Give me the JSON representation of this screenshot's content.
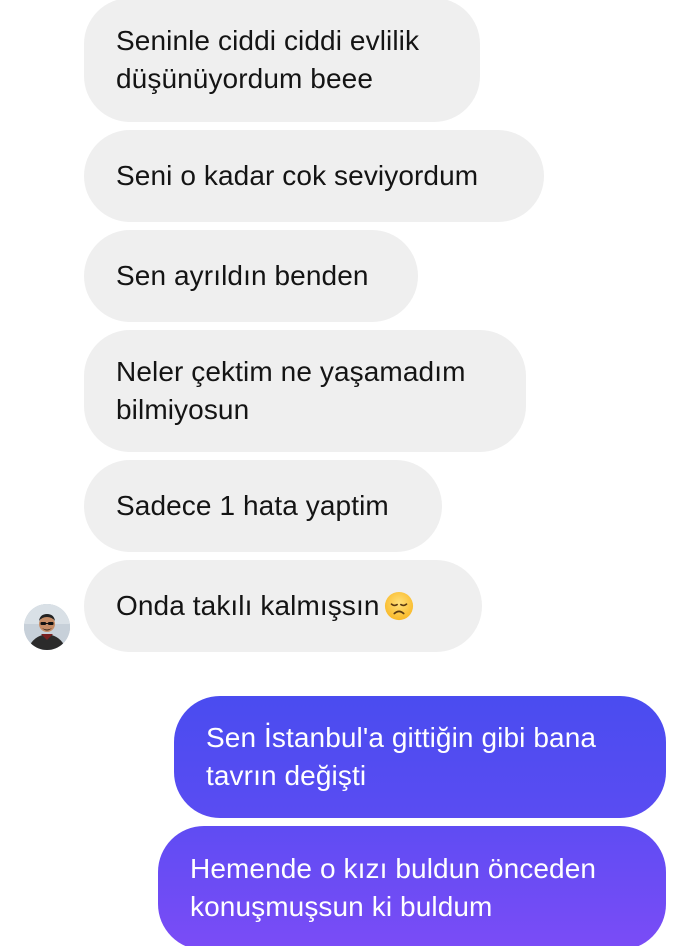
{
  "conversation": {
    "received": [
      {
        "text": "Seninle ciddi ciddi evlilik\ndüşünüyordum beee"
      },
      {
        "text": "Seni o kadar cok seviyordum"
      },
      {
        "text": "Sen ayrıldın benden"
      },
      {
        "text": "Neler çektim ne yaşamadım\nbilmiyosun"
      },
      {
        "text": "Sadece 1 hata yaptim"
      },
      {
        "text": "Onda takılı  kalmışsın",
        "emoji": "disappointed-face"
      }
    ],
    "sent": [
      {
        "text": "Sen İstanbul'a gittiğin gibi bana\ntavrın değişti"
      },
      {
        "text": "Hemende o kızı buldun önceden\nkonuşmuşsun ki buldum"
      }
    ]
  },
  "colors": {
    "received_bubble": "#efefef",
    "received_text": "#141414",
    "sent_gradient_top": "#4a4cf0",
    "sent_gradient_bottom": "#7b4cf6",
    "sent_text": "#ffffff"
  }
}
